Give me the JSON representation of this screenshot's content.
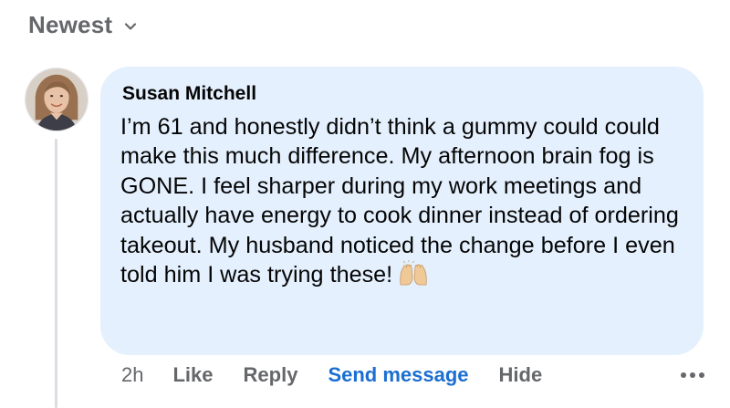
{
  "sort": {
    "label": "Newest"
  },
  "comment": {
    "author": "Susan Mitchell",
    "text": "I’m 61 and honestly didn’t think a gummy could could make this much difference. My afternoon brain fog is GONE. I feel sharper during my work meetings and actually have energy to cook dinner instead of ordering takeout. My husband noticed the change before I even told him I was trying these!",
    "emoji": "raising-hands-emoji"
  },
  "actions": {
    "time": "2h",
    "like": "Like",
    "reply": "Reply",
    "send_message": "Send message",
    "hide": "Hide"
  },
  "colors": {
    "bubble": "#e4f0fd",
    "link_blue": "#1a6fd1",
    "muted_text": "#65676b"
  }
}
